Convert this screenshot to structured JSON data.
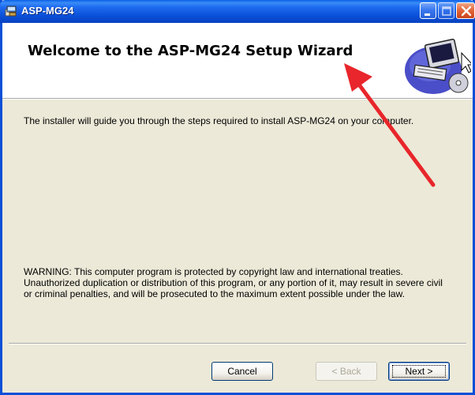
{
  "window": {
    "title": "ASP-MG24",
    "icon": "installer-package-icon",
    "controls": [
      "minimize-icon",
      "maximize-icon",
      "close-icon"
    ],
    "colors": {
      "titlebar": "#0a4fd8",
      "close": "#e4673c",
      "face": "#ece9d8"
    }
  },
  "banner": {
    "title": "Welcome to the ASP-MG24 Setup Wizard",
    "icon": "computer-setup-icon"
  },
  "body": {
    "intro": "The installer will guide you through the steps required to install ASP-MG24 on your computer.",
    "warning_lines": [
      "WARNING: This computer program is protected by copyright law and international treaties.",
      "Unauthorized duplication or distribution of this program, or any portion of it, may result in severe civil",
      "or criminal penalties, and will be prosecuted to the maximum extent possible under the law."
    ]
  },
  "footer": {
    "cancel_label": "Cancel",
    "back_label": "< Back",
    "next_label": "Next >",
    "back_enabled": false
  },
  "annotation": {
    "type": "red-arrow",
    "color": "#e8262b",
    "points_to": "banner-title"
  }
}
